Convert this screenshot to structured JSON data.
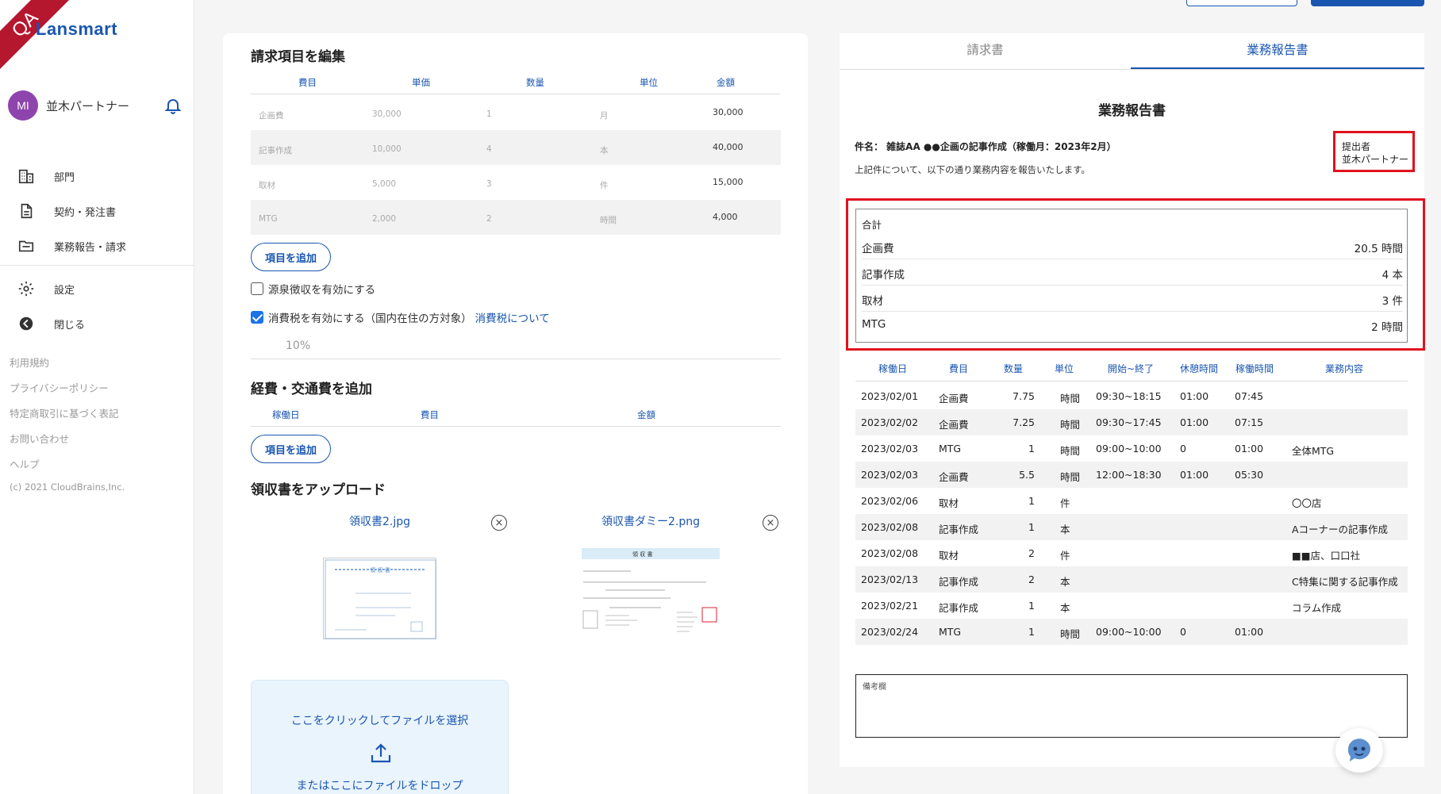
{
  "app": {
    "logo": "Lansmart",
    "ribbon": "QA"
  },
  "user": {
    "initials": "MI",
    "name": "並木パートナー"
  },
  "nav": [
    {
      "label": "部門",
      "icon": "building-icon"
    },
    {
      "label": "契約・発注書",
      "icon": "document-icon"
    },
    {
      "label": "業務報告・請求",
      "icon": "folder-icon"
    }
  ],
  "nav2": [
    {
      "label": "設定",
      "icon": "gear-icon"
    },
    {
      "label": "閉じる",
      "icon": "back-arrow-icon"
    }
  ],
  "footer_links": [
    "利用規約",
    "プライバシーポリシー",
    "特定商取引に基づく表記",
    "お問い合わせ",
    "ヘルプ"
  ],
  "copyright": "(c) 2021 CloudBrains,Inc.",
  "billing": {
    "title": "請求項目を編集",
    "headers": [
      "費目",
      "単価",
      "数量",
      "単位",
      "金額"
    ],
    "rows": [
      {
        "item": "企画費",
        "price": "30,000",
        "qty": "1",
        "unit": "月",
        "amount": "30,000"
      },
      {
        "item": "記事作成",
        "price": "10,000",
        "qty": "4",
        "unit": "本",
        "amount": "40,000"
      },
      {
        "item": "取材",
        "price": "5,000",
        "qty": "3",
        "unit": "件",
        "amount": "15,000"
      },
      {
        "item": "MTG",
        "price": "2,000",
        "qty": "2",
        "unit": "時間",
        "amount": "4,000"
      }
    ],
    "add_button": "項目を追加",
    "withholding_label": "源泉徴収を有効にする",
    "tax_label": "消費税を有効にする（国内在住の方対象）",
    "tax_link": "消費税について",
    "tax_rate": "10%"
  },
  "expenses": {
    "title": "経費・交通費を追加",
    "headers": [
      "稼働日",
      "費目",
      "金額"
    ],
    "add_button": "項目を追加"
  },
  "receipts": {
    "title": "領収書をアップロード",
    "files": [
      "領収書2.jpg",
      "領収書ダミー2.png"
    ],
    "upload_click": "ここをクリックしてファイルを選択",
    "upload_drop": "またはここにファイルをドロップ"
  },
  "tabs": [
    "請求書",
    "業務報告書"
  ],
  "report": {
    "title": "業務報告書",
    "subject": "件名： 雑誌AA ●●企画の記事作成（稼働月：2023年2月）",
    "description": "上記件について、以下の通り業務内容を報告いたします。",
    "submitter_label": "提出者",
    "submitter_name": "並木パートナー",
    "summary_label": "合計",
    "summary": [
      {
        "item": "企画費",
        "value": "20.5 時間"
      },
      {
        "item": "記事作成",
        "value": "4 本"
      },
      {
        "item": "取材",
        "value": "3 件"
      },
      {
        "item": "MTG",
        "value": "2 時間"
      }
    ],
    "detail_headers": [
      "稼働日",
      "費目",
      "数量",
      "単位",
      "開始~終了",
      "休憩時間",
      "稼働時間",
      "業務内容"
    ],
    "details": [
      {
        "date": "2023/02/01",
        "item": "企画費",
        "qty": "7.75",
        "unit": "時間",
        "span": "09:30~18:15",
        "break": "01:00",
        "work": "07:45",
        "content": ""
      },
      {
        "date": "2023/02/02",
        "item": "企画費",
        "qty": "7.25",
        "unit": "時間",
        "span": "09:30~17:45",
        "break": "01:00",
        "work": "07:15",
        "content": ""
      },
      {
        "date": "2023/02/03",
        "item": "MTG",
        "qty": "1",
        "unit": "時間",
        "span": "09:00~10:00",
        "break": "0",
        "work": "01:00",
        "content": "全体MTG"
      },
      {
        "date": "2023/02/03",
        "item": "企画費",
        "qty": "5.5",
        "unit": "時間",
        "span": "12:00~18:30",
        "break": "01:00",
        "work": "05:30",
        "content": ""
      },
      {
        "date": "2023/02/06",
        "item": "取材",
        "qty": "1",
        "unit": "件",
        "span": "",
        "break": "",
        "work": "",
        "content": "〇〇店"
      },
      {
        "date": "2023/02/08",
        "item": "記事作成",
        "qty": "1",
        "unit": "本",
        "span": "",
        "break": "",
        "work": "",
        "content": "Aコーナーの記事作成"
      },
      {
        "date": "2023/02/08",
        "item": "取材",
        "qty": "2",
        "unit": "件",
        "span": "",
        "break": "",
        "work": "",
        "content": "■■店、口口社"
      },
      {
        "date": "2023/02/13",
        "item": "記事作成",
        "qty": "2",
        "unit": "本",
        "span": "",
        "break": "",
        "work": "",
        "content": "C特集に関する記事作成"
      },
      {
        "date": "2023/02/21",
        "item": "記事作成",
        "qty": "1",
        "unit": "本",
        "span": "",
        "break": "",
        "work": "",
        "content": "コラム作成"
      },
      {
        "date": "2023/02/24",
        "item": "MTG",
        "qty": "1",
        "unit": "時間",
        "span": "09:00~10:00",
        "break": "0",
        "work": "01:00",
        "content": ""
      }
    ],
    "remarks_label": "備考欄"
  }
}
